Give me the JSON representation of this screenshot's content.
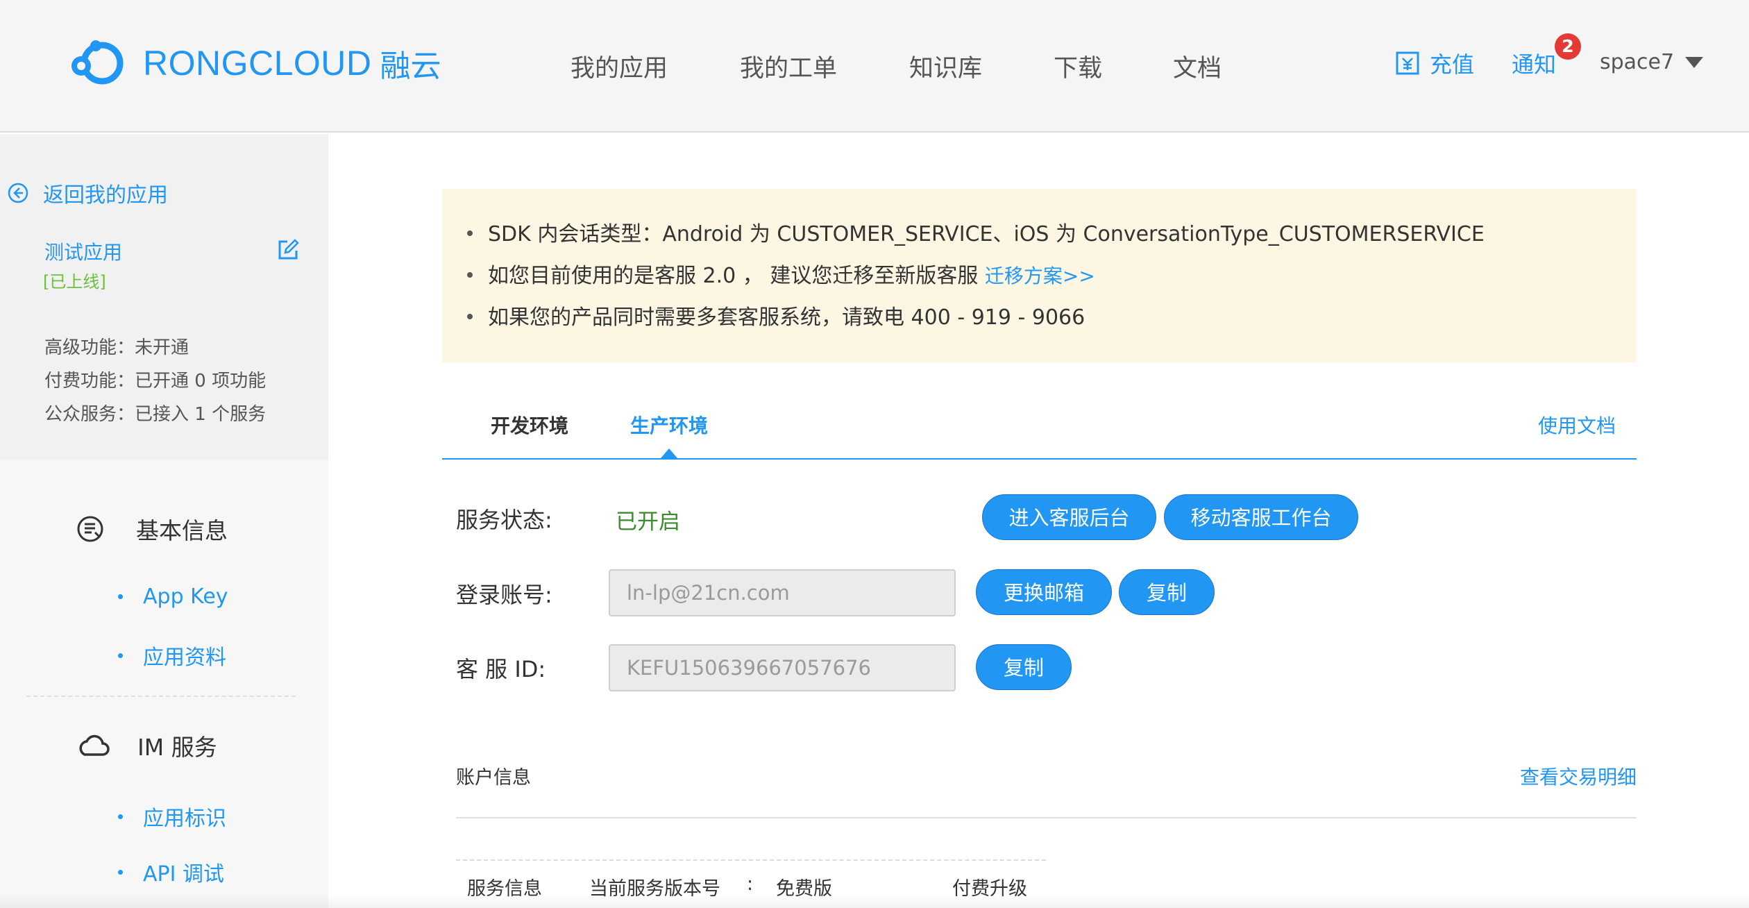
{
  "header": {
    "logo_text": "RONGCLOUD",
    "logo_cn": "融云",
    "nav": [
      "我的应用",
      "我的工单",
      "知识库",
      "下载",
      "文档"
    ],
    "recharge": "充值",
    "notify": "通知",
    "notify_count": "2",
    "username": "space7"
  },
  "sidebar": {
    "back": "返回我的应用",
    "app_name": "测试应用",
    "app_status": "[已上线]",
    "info": [
      "高级功能：未开通",
      "付费功能：已开通 0 项功能",
      "公众服务：已接入 1 个服务"
    ],
    "sections": [
      {
        "title": "基本信息",
        "items": [
          "App Key",
          "应用资料"
        ]
      },
      {
        "title": "IM 服务",
        "items": [
          "应用标识",
          "API 调试"
        ]
      }
    ]
  },
  "notice": {
    "line1": "SDK 内会话类型：Android 为 CUSTOMER_SERVICE、iOS 为 ConversationType_CUSTOMERSERVICE",
    "line2": "如您目前使用的是客服 2.0 ，  建议您迁移至新版客服 ",
    "line2_link": "迁移方案>>",
    "line3": "如果您的产品同时需要多套客服系统，请致电 400 - 919 - 9066"
  },
  "tabs": {
    "items": [
      "开发环境",
      "生产环境"
    ],
    "active": "生产环境",
    "doc_link": "使用文档"
  },
  "form": {
    "service_status_label": "服务状态:",
    "service_status": "已开启",
    "enter_backend": "进入客服后台",
    "mobile_workbench": "移动客服工作台",
    "account_label": "登录账号:",
    "account_value": "ln-lp@21cn.com",
    "change_email": "更换邮箱",
    "copy": "复制",
    "kefu_label": "客 服 ID:",
    "kefu_value": "KEFU150639667057676"
  },
  "account": {
    "title": "账户信息",
    "detail_link": "查看交易明细",
    "service_info": "服务信息",
    "version_label": "当前服务版本号",
    "colon": ":",
    "version": "免费版",
    "upgrade": "付费升级"
  }
}
